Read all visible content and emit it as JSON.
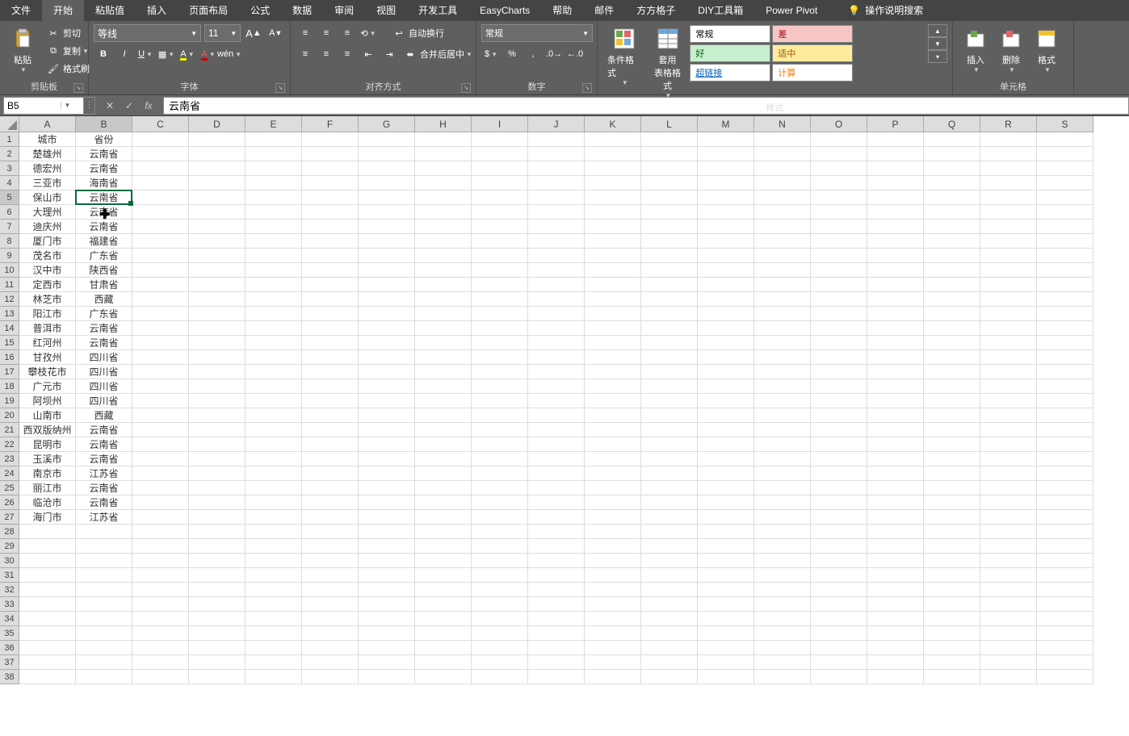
{
  "menu": {
    "items": [
      "文件",
      "开始",
      "粘贴值",
      "插入",
      "页面布局",
      "公式",
      "数据",
      "审阅",
      "视图",
      "开发工具",
      "EasyCharts",
      "帮助",
      "邮件",
      "方方格子",
      "DIY工具箱",
      "Power Pivot"
    ],
    "active": 1,
    "tell": "操作说明搜索"
  },
  "ribbon": {
    "clipboard": {
      "label": "剪贴板",
      "paste": "粘贴",
      "cut": "剪切",
      "copy": "复制",
      "painter": "格式刷"
    },
    "font": {
      "label": "字体",
      "name": "等线",
      "size": "11"
    },
    "align": {
      "label": "对齐方式",
      "wrap": "自动换行",
      "merge": "合并后居中"
    },
    "number": {
      "label": "数字",
      "format": "常规"
    },
    "styles": {
      "label": "样式",
      "cond": "条件格式",
      "table": "套用\n表格格式",
      "items": [
        {
          "t": "常规",
          "bg": "#fff",
          "c": "#000"
        },
        {
          "t": "差",
          "bg": "#f6c6c6",
          "c": "#9c0006"
        },
        {
          "t": "好",
          "bg": "#c6efce",
          "c": "#006100"
        },
        {
          "t": "适中",
          "bg": "#ffeb9c",
          "c": "#9c5700"
        },
        {
          "t": "超链接",
          "bg": "#fff",
          "c": "#0563c1",
          "u": true
        },
        {
          "t": "计算",
          "bg": "#fff",
          "c": "#fa7d00"
        }
      ]
    },
    "cells": {
      "label": "单元格",
      "insert": "插入",
      "delete": "删除",
      "format": "格式"
    }
  },
  "fbar": {
    "name": "B5",
    "formula": "云南省"
  },
  "grid": {
    "colWidths": {
      "A": 70,
      "B": 70,
      "other": 70
    },
    "cols": [
      "A",
      "B",
      "C",
      "D",
      "E",
      "F",
      "G",
      "H",
      "I",
      "J",
      "K",
      "L",
      "M",
      "N",
      "O",
      "P",
      "Q",
      "R",
      "S"
    ],
    "rowCount": 38,
    "activeCell": {
      "r": 5,
      "c": 2
    },
    "cursor": {
      "r": 6,
      "c": 2
    },
    "data": [
      [
        "城市",
        "省份"
      ],
      [
        "楚雄州",
        "云南省"
      ],
      [
        "德宏州",
        "云南省"
      ],
      [
        "三亚市",
        "海南省"
      ],
      [
        "保山市",
        "云南省"
      ],
      [
        "大理州",
        "云南省"
      ],
      [
        "迪庆州",
        "云南省"
      ],
      [
        "厦门市",
        "福建省"
      ],
      [
        "茂名市",
        "广东省"
      ],
      [
        "汉中市",
        "陕西省"
      ],
      [
        "定西市",
        "甘肃省"
      ],
      [
        "林芝市",
        "西藏"
      ],
      [
        "阳江市",
        "广东省"
      ],
      [
        "普洱市",
        "云南省"
      ],
      [
        "红河州",
        "云南省"
      ],
      [
        "甘孜州",
        "四川省"
      ],
      [
        "攀枝花市",
        "四川省"
      ],
      [
        "广元市",
        "四川省"
      ],
      [
        "阿坝州",
        "四川省"
      ],
      [
        "山南市",
        "西藏"
      ],
      [
        "西双版纳州",
        "云南省"
      ],
      [
        "昆明市",
        "云南省"
      ],
      [
        "玉溪市",
        "云南省"
      ],
      [
        "南京市",
        "江苏省"
      ],
      [
        "丽江市",
        "云南省"
      ],
      [
        "临沧市",
        "云南省"
      ],
      [
        "海门市",
        "江苏省"
      ]
    ]
  }
}
